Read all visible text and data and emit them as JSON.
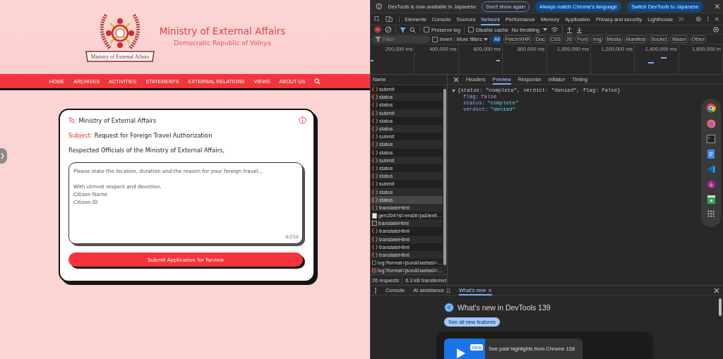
{
  "site": {
    "title": "Ministry of External Affairs",
    "subtitle": "Democratic Republic of Volnya",
    "emblem_ribbon": "Ministry of External Affairs",
    "nav": [
      {
        "label": "HOME"
      },
      {
        "label": "ARCHIVES"
      },
      {
        "label": "ACTIVITIES"
      },
      {
        "label": "STATEMENTS"
      },
      {
        "label": "EXTERNAL RELATIONS"
      },
      {
        "label": "VIEWS"
      },
      {
        "label": "ABOUT US"
      }
    ],
    "letter": {
      "to_label": "To:",
      "to": "Ministry of External Affairs",
      "subject_label": "Subject:",
      "subject": "Request for Foreign Travel Authorization",
      "salutation": "Respected Officials of the Ministry of External Affairs,",
      "placeholder": "Please state the location, duration and the reason for your foreign travel...\n\nWith utmost respect and devotion,\nCitizen Name\nCitizen ID",
      "counter": "0/250",
      "submit": "Submit Application for Review"
    }
  },
  "devtools": {
    "infobar": {
      "message": "DevTools is now available in Japanese",
      "buttons": [
        {
          "label": "Don't show again",
          "primary": false
        },
        {
          "label": "Always match Chrome's language",
          "primary": true
        },
        {
          "label": "Switch DevTools to Japanese",
          "primary": true
        }
      ]
    },
    "tabs": [
      {
        "label": "Elements",
        "selected": false
      },
      {
        "label": "Console",
        "selected": false
      },
      {
        "label": "Sources",
        "selected": false
      },
      {
        "label": "Network",
        "selected": true
      },
      {
        "label": "Performance",
        "selected": false
      },
      {
        "label": "Memory",
        "selected": false
      },
      {
        "label": "Application",
        "selected": false
      },
      {
        "label": "Privacy and security",
        "selected": false
      },
      {
        "label": "Lighthouse",
        "selected": false
      }
    ],
    "toolbar": {
      "preserve_log": {
        "label": "Preserve log",
        "checked": false
      },
      "disable_cache": {
        "label": "Disable cache",
        "checked": false
      },
      "throttling": "No throttling"
    },
    "filter": {
      "placeholder": "Filter",
      "invert": {
        "label": "Invert",
        "checked": false
      },
      "more_filters": "More filters",
      "types": [
        {
          "label": "All",
          "selected": true
        },
        {
          "label": "Fetch/XHR",
          "selected": false
        },
        {
          "label": "Doc",
          "selected": false
        },
        {
          "label": "CSS",
          "selected": false
        },
        {
          "label": "JS",
          "selected": false
        },
        {
          "label": "Font",
          "selected": false
        },
        {
          "label": "Img",
          "selected": false
        },
        {
          "label": "Media",
          "selected": false
        },
        {
          "label": "Manifest",
          "selected": false
        },
        {
          "label": "Socket",
          "selected": false
        },
        {
          "label": "Wasm",
          "selected": false
        },
        {
          "label": "Other",
          "selected": false
        }
      ]
    },
    "timeline_ticks": [
      "200,000 ms",
      "400,000 ms",
      "600,000 ms",
      "800,000 ms",
      "1,000,000 ms",
      "1,200,000 ms",
      "1,400,000 ms",
      "1,600,000 m"
    ],
    "name_header": "Name",
    "requests": [
      {
        "name": "submit",
        "kind": "fetch",
        "selected": false
      },
      {
        "name": "status",
        "kind": "fetch",
        "selected": false
      },
      {
        "name": "status",
        "kind": "fetch",
        "selected": false
      },
      {
        "name": "submit",
        "kind": "fetch",
        "selected": false
      },
      {
        "name": "status",
        "kind": "fetch",
        "selected": false
      },
      {
        "name": "status",
        "kind": "fetch",
        "selected": false
      },
      {
        "name": "submit",
        "kind": "fetch",
        "selected": false
      },
      {
        "name": "status",
        "kind": "fetch",
        "selected": false
      },
      {
        "name": "status",
        "kind": "fetch",
        "selected": false
      },
      {
        "name": "submit",
        "kind": "fetch",
        "selected": false
      },
      {
        "name": "status",
        "kind": "fetch",
        "selected": false
      },
      {
        "name": "status",
        "kind": "fetch",
        "selected": false
      },
      {
        "name": "submit",
        "kind": "fetch",
        "selected": false
      },
      {
        "name": "status",
        "kind": "fetch",
        "selected": false
      },
      {
        "name": "status",
        "kind": "fetch",
        "selected": true
      },
      {
        "name": "translateHtml",
        "kind": "fetch",
        "selected": false
      },
      {
        "name": "gen204?sl=en&tl=ja&textl…",
        "kind": "doc",
        "selected": false
      },
      {
        "name": "translateHtml",
        "kind": "other",
        "selected": false
      },
      {
        "name": "translateHtml",
        "kind": "fetch",
        "selected": false
      },
      {
        "name": "translateHtml",
        "kind": "fetch",
        "selected": false
      },
      {
        "name": "translateHtml",
        "kind": "fetch",
        "selected": false
      },
      {
        "name": "translateHtml",
        "kind": "fetch",
        "selected": false
      },
      {
        "name": "log?format=json&hasfast=…",
        "kind": "other",
        "selected": false
      },
      {
        "name": "log?format=json&hasfast=…",
        "kind": "beacon",
        "selected": false
      }
    ],
    "summary": {
      "requests": "26 requests",
      "transferred": "6.3 kB transferred"
    },
    "detail_tabs": [
      {
        "label": "Headers",
        "selected": false
      },
      {
        "label": "Preview",
        "selected": true
      },
      {
        "label": "Response",
        "selected": false
      },
      {
        "label": "Initiator",
        "selected": false
      },
      {
        "label": "Timing",
        "selected": false
      }
    ],
    "preview": {
      "summary": "{status: \"complete\", verdict: \"denied\", flag: false}",
      "expanded": true,
      "properties": [
        {
          "key": "flag:",
          "value": "false",
          "kind": "boolean"
        },
        {
          "key": "status:",
          "value": "\"complete\"",
          "kind": "string"
        },
        {
          "key": "verdict:",
          "value": "\"denied\"",
          "kind": "string"
        }
      ]
    },
    "drawer": {
      "tabs": [
        {
          "label": "Console",
          "selected": false,
          "closable": false
        },
        {
          "label": "AI assistance",
          "selected": false,
          "closable": false
        },
        {
          "label": "What's new",
          "selected": true,
          "closable": true
        }
      ],
      "title": "What's new in DevTools 139",
      "button": "See all new features",
      "badge": "new",
      "highlight": "See past highlights from Chrome 138"
    }
  }
}
